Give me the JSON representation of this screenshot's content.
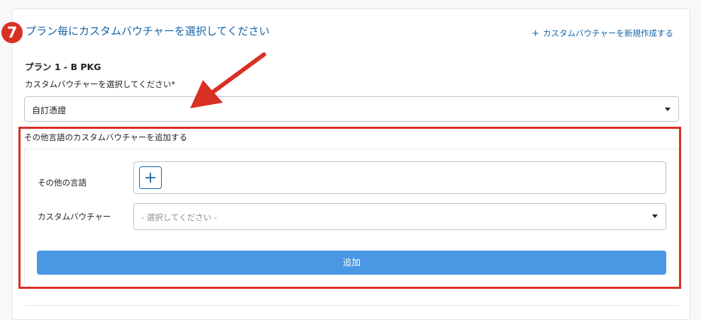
{
  "step_badge": "7",
  "section_title": "プラン毎にカスタムバウチャーを選択してください",
  "create_link": {
    "icon": "plus-icon",
    "label": "カスタムバウチャーを新規作成する"
  },
  "plan": {
    "title": "プラン 1 - B PKG",
    "field_label": "カスタムバウチャーを選択してください*",
    "selected_value": "自訂憑證"
  },
  "other_language_panel": {
    "title": "その他言語のカスタムバウチャーを追加する",
    "language_label": "その他の言語",
    "language_add_icon": "plus-icon",
    "voucher_label": "カスタムバウチャー",
    "voucher_placeholder": "- 選択してください -",
    "add_button": "追加"
  },
  "colors": {
    "accent": "#1565a8",
    "annotation_red": "#d93025",
    "button_blue": "#4a97e3"
  }
}
